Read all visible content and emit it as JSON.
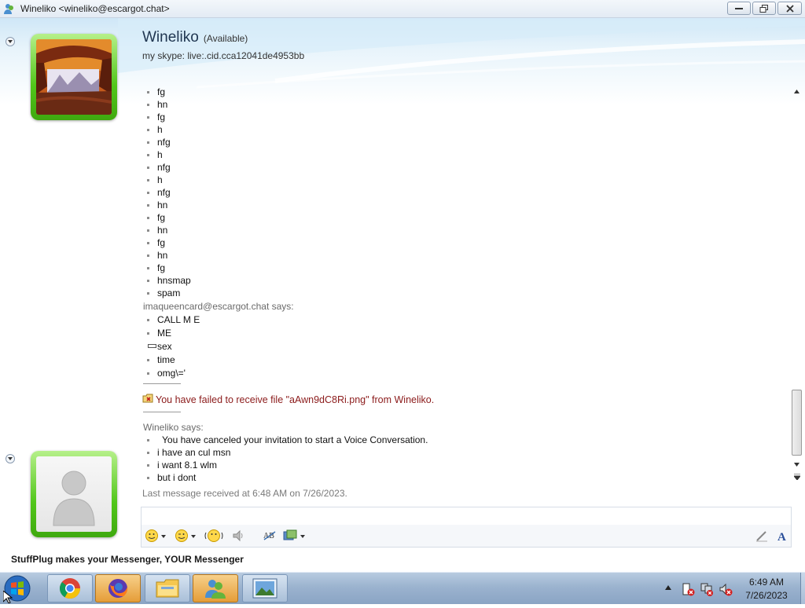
{
  "window": {
    "title": "Wineliko <wineliko@escargot.chat>"
  },
  "contact": {
    "name": "Wineliko",
    "status": "(Available)",
    "psm": "my skype: live:.cid.cca12041de4953bb"
  },
  "history": {
    "items_block1": [
      "fg",
      "hn",
      "fg",
      "h",
      "nfg",
      "h",
      "nfg",
      "h",
      "nfg",
      "hn",
      "fg",
      "hn",
      "fg",
      "hn",
      "fg",
      "hnsmap",
      "spam"
    ],
    "sender2": "imaqueencard@escargot.chat says:",
    "items_block2": [
      "CALL M E",
      "ME",
      "sex",
      "time",
      "omg\\='"
    ],
    "failed_notice": "You have failed to receive file \"aAwn9dC8Ri.png\" from Wineliko.",
    "sender3": "Wineliko says:",
    "items_block3": [
      "You have canceled your invitation to start a Voice Conversation.",
      "i have an cul msn",
      "i want 8.1 wlm",
      "but i dont"
    ],
    "last_received": "Last message received at 6:48 AM on 7/26/2023."
  },
  "ad": {
    "text": "StuffPlug makes your Messenger, YOUR Messenger"
  },
  "toolbar": {
    "icons": [
      "emoticon-icon",
      "wink-icon",
      "nudge-icon",
      "voice-clip-icon",
      "spellcheck-icon",
      "background-icon",
      "handwriting-icon",
      "font-icon"
    ]
  },
  "taskbar": {
    "apps": [
      "start-orb-icon",
      "chrome-icon",
      "firefox-icon",
      "explorer-icon",
      "messenger-icon",
      "photo-viewer-icon"
    ],
    "time": "6:49 AM",
    "date": "7/26/2023"
  },
  "colors": {
    "status_green": "#51c61a",
    "error_red": "#8b1a1a",
    "title_blue": "#1f3550"
  }
}
